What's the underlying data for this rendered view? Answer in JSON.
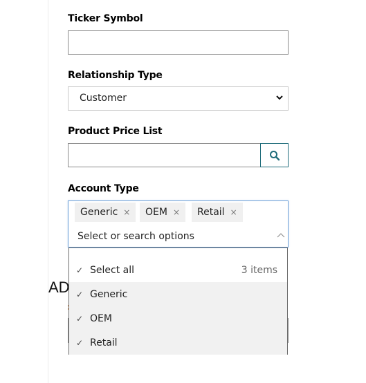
{
  "form": {
    "ticker_symbol": {
      "label": "Ticker Symbol",
      "value": ""
    },
    "relationship_type": {
      "label": "Relationship Type",
      "value": "Customer"
    },
    "product_price_list": {
      "label": "Product Price List",
      "value": "",
      "button_icon": "search-icon"
    },
    "account_type": {
      "label": "Account Type",
      "tags": [
        {
          "label": "Generic",
          "remove": "×"
        },
        {
          "label": "OEM",
          "remove": "×"
        },
        {
          "label": "Retail",
          "remove": "×"
        }
      ],
      "placeholder": "Select or search options",
      "caret_icon": "chevron-up-icon",
      "dropdown": {
        "select_all": {
          "label": "Select all",
          "check": "✓",
          "count": "3 items"
        },
        "options": [
          {
            "label": "Generic",
            "check": "✓",
            "selected": true
          },
          {
            "label": "OEM",
            "check": "✓",
            "selected": true
          },
          {
            "label": "Retail",
            "check": "✓",
            "selected": true
          }
        ]
      }
    }
  },
  "background": {
    "heading_fragment": "AD",
    "sublabel_fragment": ":"
  },
  "colors": {
    "accent_teal": "#1e6c7a",
    "focus_blue": "#6fa1d8",
    "tag_bg": "#f0f0f0",
    "selected_row_bg": "#f1f1f1"
  }
}
